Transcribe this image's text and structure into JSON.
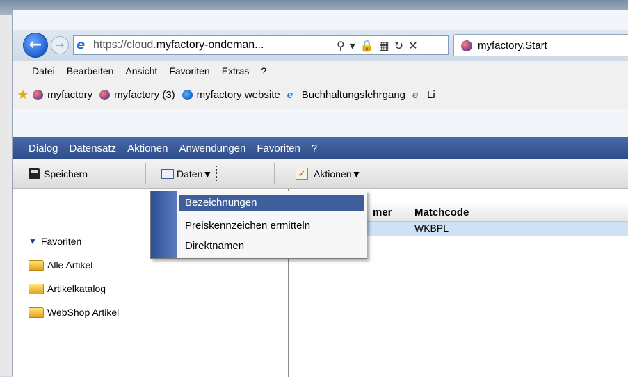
{
  "browser": {
    "url_prefix": "https://cloud.",
    "url_domain": "myfactory-ondeman...",
    "tab_title": "myfactory.Start"
  },
  "ie_menu": [
    "Datei",
    "Bearbeiten",
    "Ansicht",
    "Favoriten",
    "Extras",
    "?"
  ],
  "favorites_bar": [
    {
      "label": "myfactory",
      "icon": "myfactory-icon"
    },
    {
      "label": "myfactory (3)",
      "icon": "myfactory-icon"
    },
    {
      "label": "myfactory website",
      "icon": "website-icon"
    },
    {
      "label": "Buchhaltungslehrgang",
      "icon": "ie-page-icon"
    },
    {
      "label": "Li",
      "icon": "ie-page-icon"
    }
  ],
  "app_menu": [
    "Dialog",
    "Datensatz",
    "Aktionen",
    "Anwendungen",
    "Favoriten",
    "?"
  ],
  "toolbar": {
    "save_label": "Speichern",
    "data_label": "Daten",
    "actions_label": "Aktionen"
  },
  "tree": {
    "favorites": "Favoriten",
    "folders": [
      "Alle Artikel",
      "Artikelkatalog",
      "WebShop Artikel"
    ]
  },
  "grid": {
    "columns": [
      "mer",
      "Matchcode"
    ],
    "rows": [
      {
        "matchcode": "WKBPL"
      }
    ]
  },
  "dropdown": {
    "items": [
      "Bezeichnungen",
      "Preiskennzeichen ermitteln",
      "Direktnamen"
    ],
    "active_index": 0
  }
}
